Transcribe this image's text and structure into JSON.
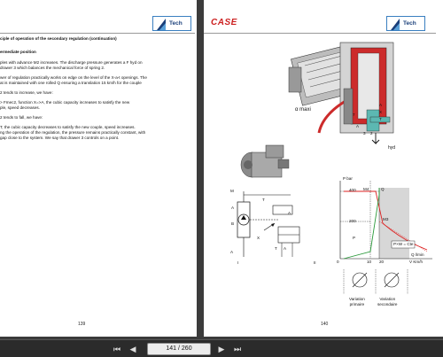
{
  "left_page": {
    "header_title": "ciple of operation of the secondary regulation (continuation)",
    "logo_text": "Tech",
    "section_title": "ermediate position",
    "lines": [
      "ples with advance M2 increases. The discharge pressure generates a F hyd on",
      "drawer 3 which balances the mechanical force of spring 2.",
      "",
      "wer of regulation practically works on edge on the level of the X-a-t openings. The",
      "at is maintained with one rolled Q ensuring a translation 15 km/h for the couple",
      "",
      "2 tends to increase, we have:",
      "",
      "> Fmec2, function X=>A, the cubic capacity increases to satisfy the new",
      "ple, speed decreases.",
      "",
      "2 tends to fall, we have:",
      "",
      "T, the cubic capacity decreases to satisfy the new couple, speed increases.",
      "ng the operation of the regulation, the pressure remains practically constant, with",
      "gap close to the system. We say that drawer 3 controls on a point."
    ],
    "page_number": "139"
  },
  "right_page": {
    "brand": "CASE",
    "logo_text": "Tech",
    "page_number": "140",
    "pump_label": "α maxi",
    "pump_callouts": [
      "7",
      "A",
      "X",
      "T",
      "A",
      "3",
      "2"
    ],
    "hyd_label": "hyd",
    "schematic_labels": [
      "M",
      "T",
      "A",
      "B",
      "A",
      "X",
      "T",
      "A",
      "X"
    ],
    "roman_I": "I",
    "roman_II": "II",
    "chart_labels": {
      "yaxis": "P bar",
      "y400": "400",
      "m4": "M4",
      "q_top": "Q",
      "y200": "200",
      "m3": "M3",
      "p_curve": "P",
      "formula": "P×W = Cte",
      "q_curve": "Q l/min",
      "x0": "0",
      "x10": "10",
      "x20": "20",
      "xaxis": "V Km/h",
      "variation_primaire": "Variation\nprimaire",
      "variation_secondaire": "Variation\nsecondaire"
    }
  },
  "toolbar": {
    "first": "⏮",
    "prev": "◀",
    "pager": "141 / 260",
    "next": "▶",
    "last": "⏭"
  }
}
